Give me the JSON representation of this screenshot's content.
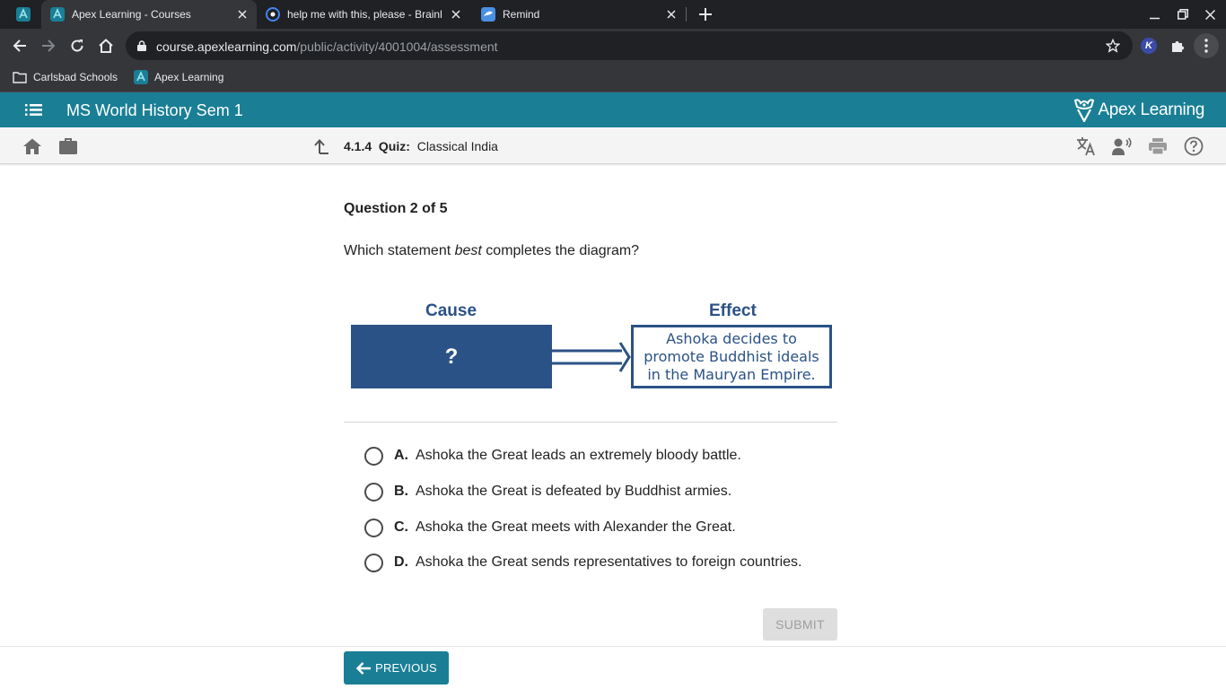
{
  "browser": {
    "tabs": [
      {
        "title": "Apex Learning - Courses",
        "active": true
      },
      {
        "title": "help me with this, please - Brainly",
        "active": false
      },
      {
        "title": "Remind",
        "active": false
      }
    ],
    "url_host": "course.apexlearning.com",
    "url_path": "/public/activity/4001004/assessment",
    "profile_initial": "K",
    "bookmarks": [
      "Carlsbad Schools",
      "Apex Learning"
    ]
  },
  "header": {
    "course_title": "MS World History Sem 1",
    "logo_text": "Apex Learning"
  },
  "activity": {
    "number": "4.1.4",
    "type": "Quiz:",
    "title": "Classical India"
  },
  "question": {
    "counter": "Question 2 of 5",
    "prompt_before": "Which statement ",
    "prompt_emphasis": "best",
    "prompt_after": " completes the diagram?"
  },
  "diagram": {
    "cause_label": "Cause",
    "effect_label": "Effect",
    "cause_text": "?",
    "effect_text": "Ashoka decides to promote Buddhist ideals in the Mauryan Empire."
  },
  "options": [
    {
      "letter": "A.",
      "text": "Ashoka the Great leads an extremely bloody battle."
    },
    {
      "letter": "B.",
      "text": "Ashoka the Great is defeated by Buddhist armies."
    },
    {
      "letter": "C.",
      "text": "Ashoka the Great meets with Alexander the Great."
    },
    {
      "letter": "D.",
      "text": "Ashoka the Great sends representatives to foreign countries."
    }
  ],
  "buttons": {
    "submit": "SUBMIT",
    "previous": "PREVIOUS"
  },
  "colors": {
    "brand_teal": "#1a7f95",
    "diagram_blue": "#2b5286"
  }
}
